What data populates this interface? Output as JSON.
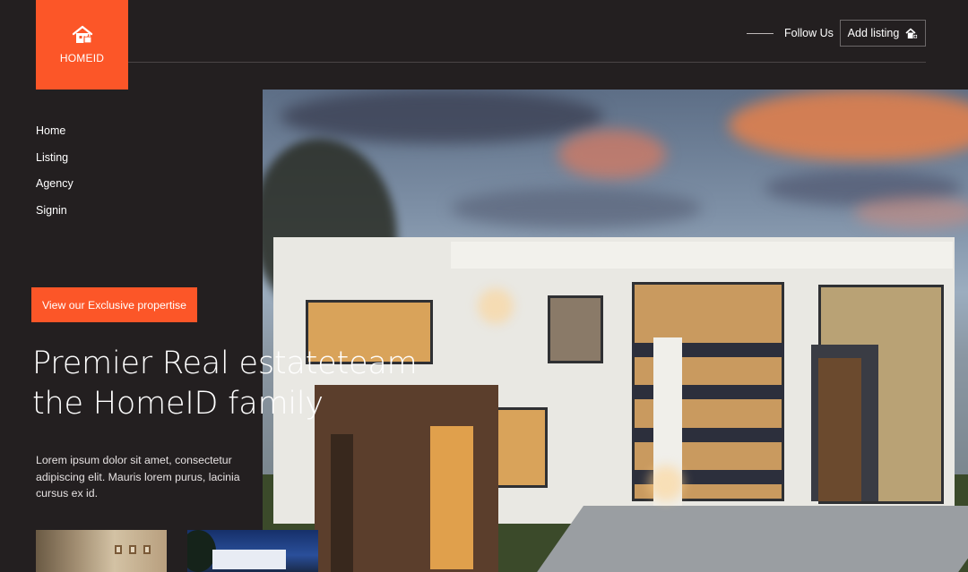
{
  "brand": {
    "name": "HOMEID",
    "color": "#fc5628",
    "logo_icon": "house-lock-icon"
  },
  "header": {
    "follow_label": "Follow Us",
    "add_listing_label": "Add listing",
    "add_listing_icon": "house-plus-icon"
  },
  "nav": {
    "items": [
      {
        "label": "Home"
      },
      {
        "label": "Listing"
      },
      {
        "label": "Agency"
      },
      {
        "label": "Signin"
      }
    ]
  },
  "hero": {
    "cta_label": "View our Exclusive propertise",
    "headline_line1": "Premier Real estateteam",
    "headline_line2": "the HomeID family",
    "description": "Lorem ipsum dolor sit amet, consectetur adipiscing elit. Mauris lorem purus, lacinia cursus ex id."
  },
  "colors": {
    "background": "#231f20",
    "accent": "#fc5628",
    "text": "#ffffff"
  }
}
